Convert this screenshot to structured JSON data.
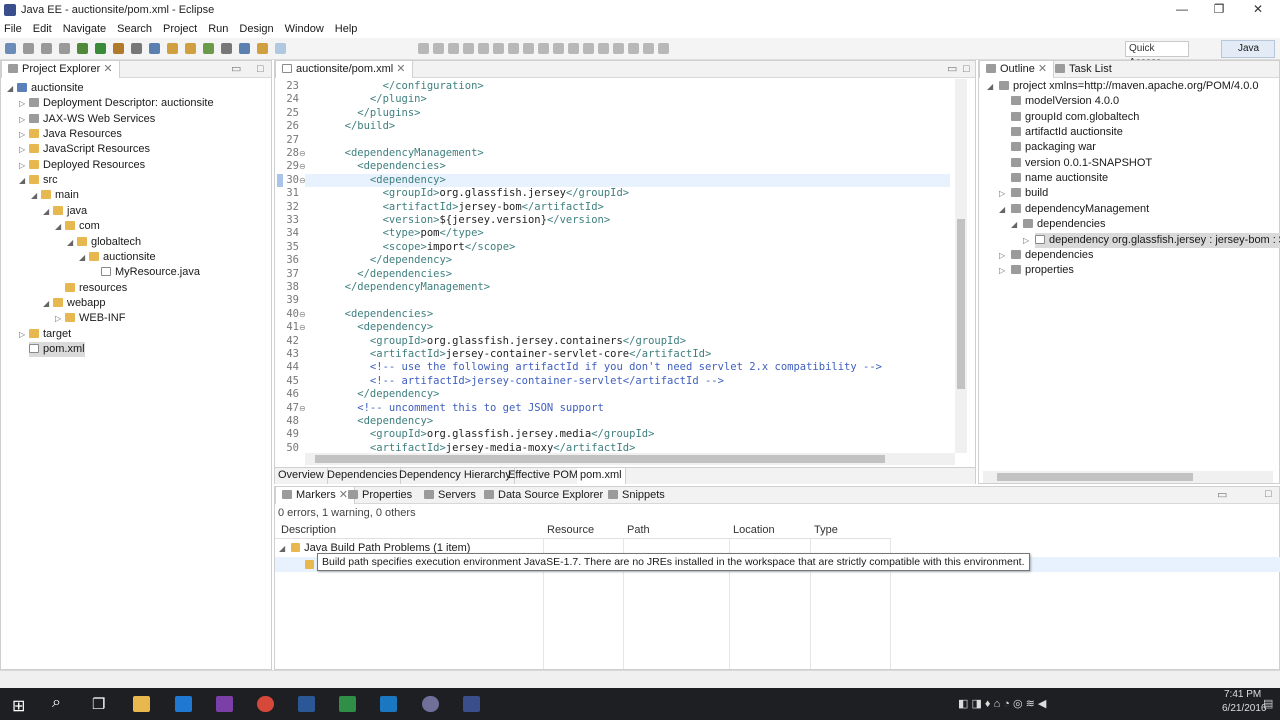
{
  "window": {
    "title": "Java EE - auctionsite/pom.xml - Eclipse",
    "min": "—",
    "max": "❐",
    "close": "✕"
  },
  "menu": [
    "File",
    "Edit",
    "Navigate",
    "Search",
    "Project",
    "Run",
    "Design",
    "Window",
    "Help"
  ],
  "toolbar": {
    "quick_access": "Quick Access",
    "perspective": "Java EE"
  },
  "project_explorer": {
    "tab": "Project Explorer",
    "items": [
      {
        "label": "auctionsite",
        "depth": 0,
        "arrow": "◢",
        "icon": "proj"
      },
      {
        "label": "Deployment Descriptor: auctionsite",
        "depth": 1,
        "arrow": "▷",
        "icon": "gray"
      },
      {
        "label": "JAX-WS Web Services",
        "depth": 1,
        "arrow": "▷",
        "icon": "gray"
      },
      {
        "label": "Java Resources",
        "depth": 1,
        "arrow": "▷",
        "icon": "folder"
      },
      {
        "label": "JavaScript Resources",
        "depth": 1,
        "arrow": "▷",
        "icon": "folder"
      },
      {
        "label": "Deployed Resources",
        "depth": 1,
        "arrow": "▷",
        "icon": "folder"
      },
      {
        "label": "src",
        "depth": 1,
        "arrow": "◢",
        "icon": "folder"
      },
      {
        "label": "main",
        "depth": 2,
        "arrow": "◢",
        "icon": "folder"
      },
      {
        "label": "java",
        "depth": 3,
        "arrow": "◢",
        "icon": "folder"
      },
      {
        "label": "com",
        "depth": 4,
        "arrow": "◢",
        "icon": "folder"
      },
      {
        "label": "globaltech",
        "depth": 5,
        "arrow": "◢",
        "icon": "folder"
      },
      {
        "label": "auctionsite",
        "depth": 6,
        "arrow": "◢",
        "icon": "folder"
      },
      {
        "label": "MyResource.java",
        "depth": 7,
        "arrow": "",
        "icon": "file"
      },
      {
        "label": "resources",
        "depth": 4,
        "arrow": "",
        "icon": "folder"
      },
      {
        "label": "webapp",
        "depth": 3,
        "arrow": "◢",
        "icon": "folder"
      },
      {
        "label": "WEB-INF",
        "depth": 4,
        "arrow": "▷",
        "icon": "folder"
      },
      {
        "label": "target",
        "depth": 1,
        "arrow": "▷",
        "icon": "folder"
      },
      {
        "label": "pom.xml",
        "depth": 1,
        "arrow": "",
        "icon": "file",
        "selected": true
      }
    ]
  },
  "editor": {
    "tab": "auctionsite/pom.xml",
    "lines": [
      {
        "n": "23",
        "fold": "",
        "segs": [
          [
            "t",
            "        </configuration>"
          ]
        ]
      },
      {
        "n": "24",
        "fold": "",
        "segs": [
          [
            "t",
            "      </plugin>"
          ]
        ]
      },
      {
        "n": "25",
        "fold": "",
        "segs": [
          [
            "t",
            "    </plugins>"
          ]
        ]
      },
      {
        "n": "26",
        "fold": "",
        "segs": [
          [
            "t",
            "  </build>"
          ]
        ]
      },
      {
        "n": "27",
        "fold": "",
        "segs": []
      },
      {
        "n": "28",
        "fold": "⊖",
        "segs": [
          [
            "t",
            "  <dependencyManagement>"
          ]
        ]
      },
      {
        "n": "29",
        "fold": "⊖",
        "segs": [
          [
            "t",
            "    <dependencies>"
          ]
        ]
      },
      {
        "n": "30",
        "fold": "⊖",
        "segs": [
          [
            "t",
            "      <dependency>"
          ]
        ],
        "highlight": true
      },
      {
        "n": "31",
        "fold": "",
        "segs": [
          [
            "t",
            "        <groupId>"
          ],
          [
            "x",
            "org.glassfish.jersey"
          ],
          [
            "t",
            "</groupId>"
          ]
        ]
      },
      {
        "n": "32",
        "fold": "",
        "segs": [
          [
            "t",
            "        <artifactId>"
          ],
          [
            "x",
            "jersey-bom"
          ],
          [
            "t",
            "</artifactId>"
          ]
        ]
      },
      {
        "n": "33",
        "fold": "",
        "segs": [
          [
            "t",
            "        <version>"
          ],
          [
            "x",
            "${jersey.version}"
          ],
          [
            "t",
            "</version>"
          ]
        ]
      },
      {
        "n": "34",
        "fold": "",
        "segs": [
          [
            "t",
            "        <type>"
          ],
          [
            "x",
            "pom"
          ],
          [
            "t",
            "</type>"
          ]
        ]
      },
      {
        "n": "35",
        "fold": "",
        "segs": [
          [
            "t",
            "        <scope>"
          ],
          [
            "x",
            "import"
          ],
          [
            "t",
            "</scope>"
          ]
        ]
      },
      {
        "n": "36",
        "fold": "",
        "segs": [
          [
            "t",
            "      </dependency>"
          ]
        ]
      },
      {
        "n": "37",
        "fold": "",
        "segs": [
          [
            "t",
            "    </dependencies>"
          ]
        ]
      },
      {
        "n": "38",
        "fold": "",
        "segs": [
          [
            "t",
            "  </dependencyManagement>"
          ]
        ]
      },
      {
        "n": "39",
        "fold": "",
        "segs": []
      },
      {
        "n": "40",
        "fold": "⊖",
        "segs": [
          [
            "t",
            "  <dependencies>"
          ]
        ]
      },
      {
        "n": "41",
        "fold": "⊖",
        "segs": [
          [
            "t",
            "    <dependency>"
          ]
        ]
      },
      {
        "n": "42",
        "fold": "",
        "segs": [
          [
            "t",
            "      <groupId>"
          ],
          [
            "x",
            "org.glassfish.jersey.containers"
          ],
          [
            "t",
            "</groupId>"
          ]
        ]
      },
      {
        "n": "43",
        "fold": "",
        "segs": [
          [
            "t",
            "      <artifactId>"
          ],
          [
            "x",
            "jersey-container-servlet-core"
          ],
          [
            "t",
            "</artifactId>"
          ]
        ]
      },
      {
        "n": "44",
        "fold": "",
        "segs": [
          [
            "c",
            "      <!-- use the following artifactId if you don't need servlet 2.x compatibility -->"
          ]
        ]
      },
      {
        "n": "45",
        "fold": "",
        "segs": [
          [
            "c",
            "      <!-- artifactId>jersey-container-servlet</artifactId -->"
          ]
        ]
      },
      {
        "n": "46",
        "fold": "",
        "segs": [
          [
            "t",
            "    </dependency>"
          ]
        ]
      },
      {
        "n": "47",
        "fold": "⊖",
        "segs": [
          [
            "c",
            "    <!-- uncomment this to get JSON support"
          ]
        ]
      },
      {
        "n": "48",
        "fold": "",
        "segs": [
          [
            "t",
            "    <dependency>"
          ]
        ]
      },
      {
        "n": "49",
        "fold": "",
        "segs": [
          [
            "t",
            "      <groupId>"
          ],
          [
            "x",
            "org.glassfish.jersey.media"
          ],
          [
            "t",
            "</groupId>"
          ]
        ]
      },
      {
        "n": "50",
        "fold": "",
        "segs": [
          [
            "t",
            "      <artifactId>"
          ],
          [
            "x",
            "jersey-media-moxy"
          ],
          [
            "t",
            "</artifactId>"
          ]
        ]
      }
    ],
    "bottom_tabs": [
      "Overview",
      "Dependencies",
      "Dependency Hierarchy",
      "Effective POM",
      "pom.xml"
    ]
  },
  "outline": {
    "tabs": [
      "Outline",
      "Task List"
    ],
    "items": [
      {
        "label": "project xmlns=http://maven.apache.org/POM/4.0.0",
        "depth": 0,
        "arrow": "◢"
      },
      {
        "label": "modelVersion  4.0.0",
        "depth": 1,
        "arrow": ""
      },
      {
        "label": "groupId  com.globaltech",
        "depth": 1,
        "arrow": ""
      },
      {
        "label": "artifactId  auctionsite",
        "depth": 1,
        "arrow": ""
      },
      {
        "label": "packaging  war",
        "depth": 1,
        "arrow": ""
      },
      {
        "label": "version  0.0.1-SNAPSHOT",
        "depth": 1,
        "arrow": ""
      },
      {
        "label": "name  auctionsite",
        "depth": 1,
        "arrow": ""
      },
      {
        "label": "build",
        "depth": 1,
        "arrow": "▷"
      },
      {
        "label": "dependencyManagement",
        "depth": 1,
        "arrow": "◢"
      },
      {
        "label": "dependencies",
        "depth": 2,
        "arrow": "◢"
      },
      {
        "label": "dependency  org.glassfish.jersey : jersey-bom : ${jers",
        "depth": 3,
        "arrow": "▷",
        "selected": true
      },
      {
        "label": "dependencies",
        "depth": 1,
        "arrow": "▷"
      },
      {
        "label": "properties",
        "depth": 1,
        "arrow": "▷"
      }
    ]
  },
  "markers": {
    "tabs": [
      "Markers",
      "Properties",
      "Servers",
      "Data Source Explorer",
      "Snippets"
    ],
    "summary": "0 errors, 1 warning, 0 others",
    "columns": [
      "Description",
      "Resource",
      "Path",
      "Location",
      "Type"
    ],
    "group": "Java Build Path Problems (1 item)",
    "tooltip": "Build path specifies execution environment JavaSE-1.7. There are no JREs installed in the workspace that are strictly compatible with this environment."
  },
  "taskbar": {
    "time": "7:41 PM",
    "date": "6/21/2016"
  }
}
